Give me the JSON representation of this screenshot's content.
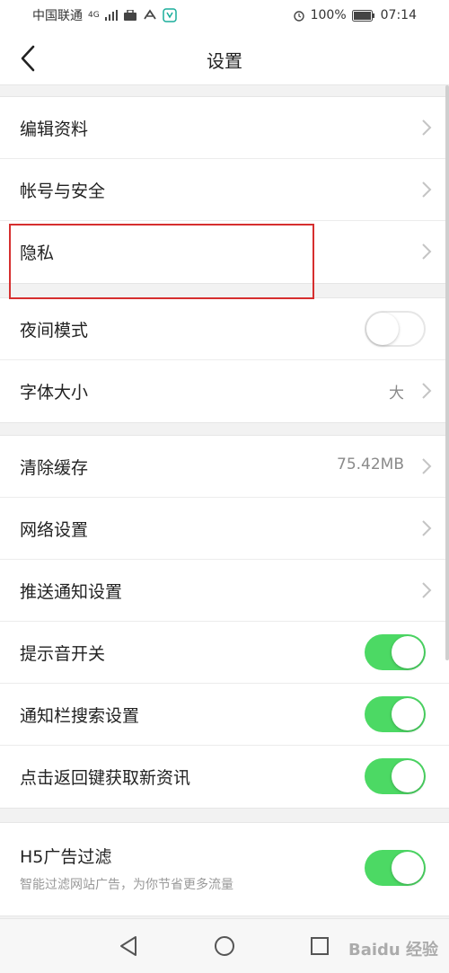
{
  "status_bar": {
    "carrier": "中国联通",
    "network": "4G",
    "battery": "100%",
    "time": "07:14"
  },
  "header": {
    "title": "设置"
  },
  "groups": [
    {
      "rows": [
        {
          "label": "编辑资料",
          "type": "chevron"
        },
        {
          "label": "帐号与安全",
          "type": "chevron"
        },
        {
          "label": "隐私",
          "type": "chevron"
        }
      ]
    },
    {
      "rows": [
        {
          "label": "夜间模式",
          "type": "toggle",
          "on": false
        },
        {
          "label": "字体大小",
          "type": "chevron",
          "value": "大"
        }
      ]
    },
    {
      "rows": [
        {
          "label": "清除缓存",
          "type": "chevron",
          "value": "75.42MB"
        },
        {
          "label": "网络设置",
          "type": "chevron"
        },
        {
          "label": "推送通知设置",
          "type": "chevron"
        },
        {
          "label": "提示音开关",
          "type": "toggle",
          "on": true
        },
        {
          "label": "通知栏搜索设置",
          "type": "toggle",
          "on": true
        },
        {
          "label": "点击返回键获取新资讯",
          "type": "toggle",
          "on": true
        }
      ]
    },
    {
      "rows": [
        {
          "label": "H5广告过滤",
          "type": "toggle",
          "on": true,
          "subtitle": "智能过滤网站广告，为你节省更多流量"
        }
      ]
    }
  ],
  "colors": {
    "toggle_on": "#4cd964",
    "highlight": "#d62f2f"
  },
  "watermark": "Baidu 经验"
}
